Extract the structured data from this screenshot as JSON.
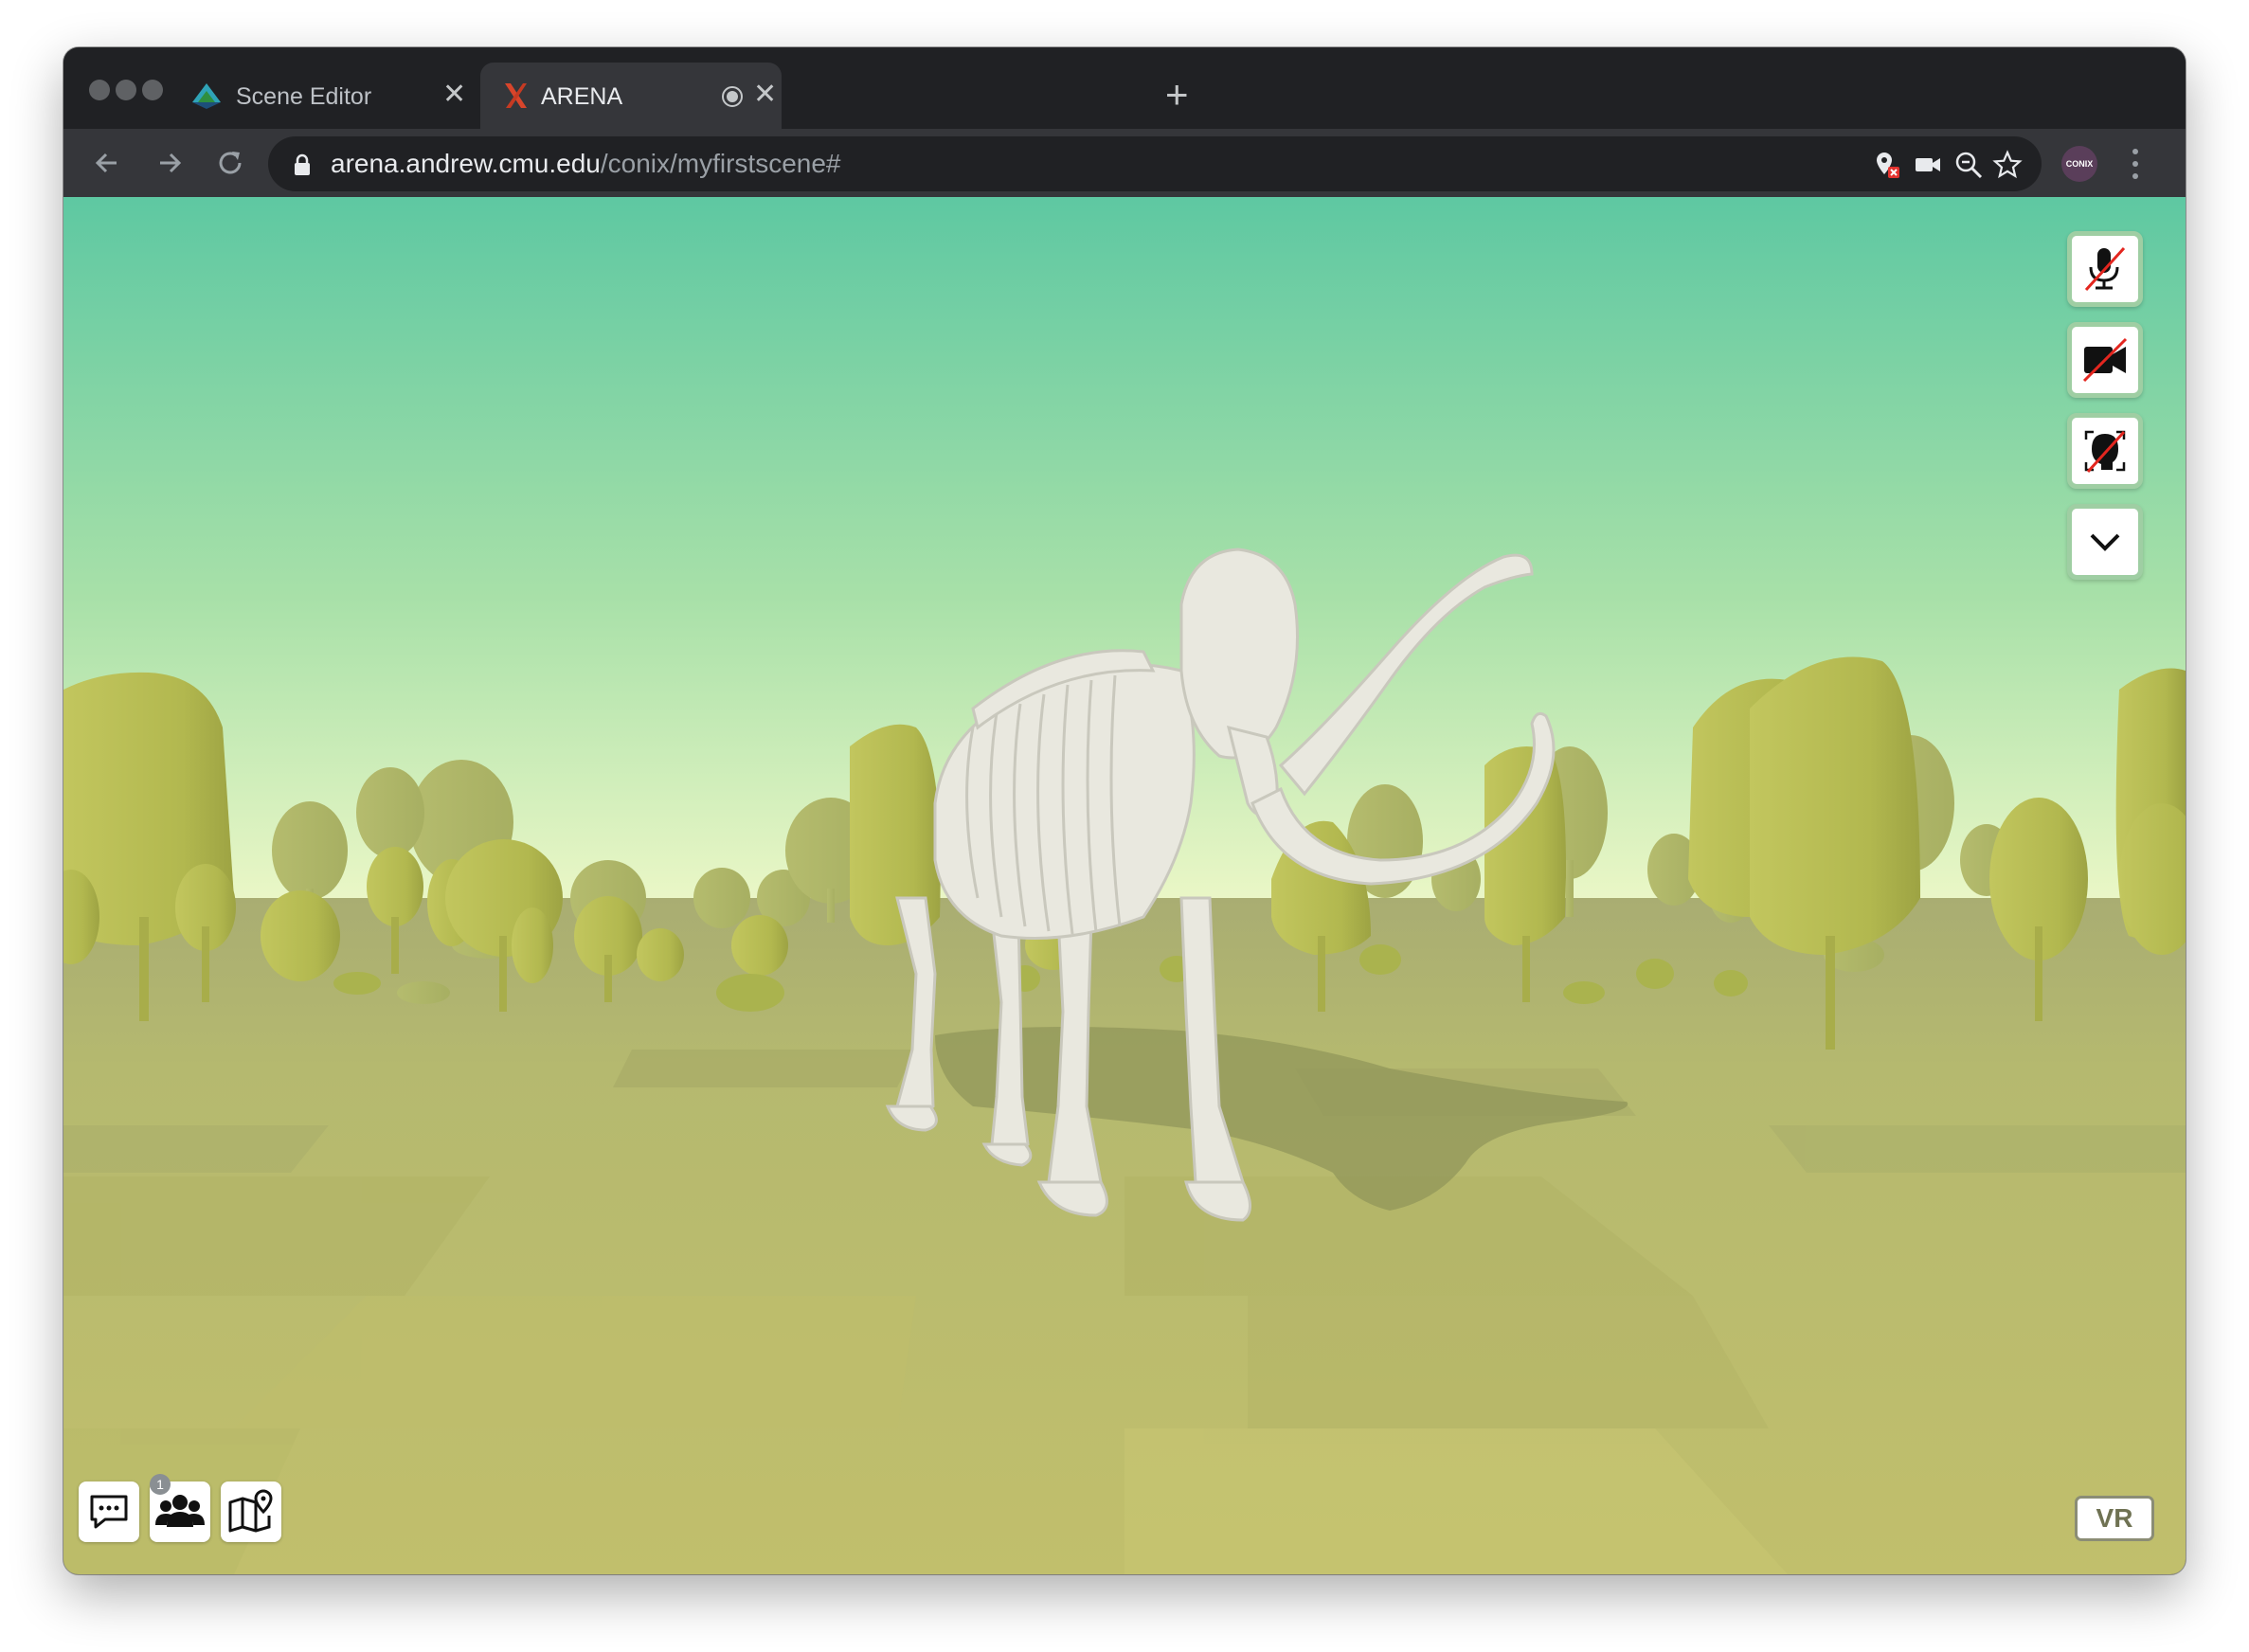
{
  "browser": {
    "tabs": [
      {
        "title": "Scene Editor",
        "icon": "scene-editor-favicon",
        "active": false
      },
      {
        "title": "ARENA",
        "icon": "arena-x-favicon",
        "active": true,
        "recording": true
      }
    ],
    "url": {
      "host": "arena.andrew.cmu.edu",
      "path": "/conix/myfirstscene#"
    },
    "profile_label": "CONIX",
    "toolbar_icons": [
      "location-blocked-icon",
      "camera-icon",
      "zoom-icon",
      "bookmark-star-icon"
    ]
  },
  "arena": {
    "side_controls": [
      {
        "name": "mic-muted-icon",
        "state": "off"
      },
      {
        "name": "video-off-icon",
        "state": "off"
      },
      {
        "name": "avatar-off-icon",
        "state": "off"
      },
      {
        "name": "chevron-down-icon",
        "state": "collapse"
      }
    ],
    "bottom_controls": [
      "chat-icon",
      "users-icon",
      "map-icon"
    ],
    "user_count": "1",
    "vr_label": "VR"
  },
  "colors": {
    "sky_top": "#5ec8a2",
    "sky_horizon": "#eaf6c6",
    "ground": "#b9bd6e",
    "tree": "#b7c05a",
    "bone": "#e9e8df",
    "button_border": "#9fcea3"
  }
}
